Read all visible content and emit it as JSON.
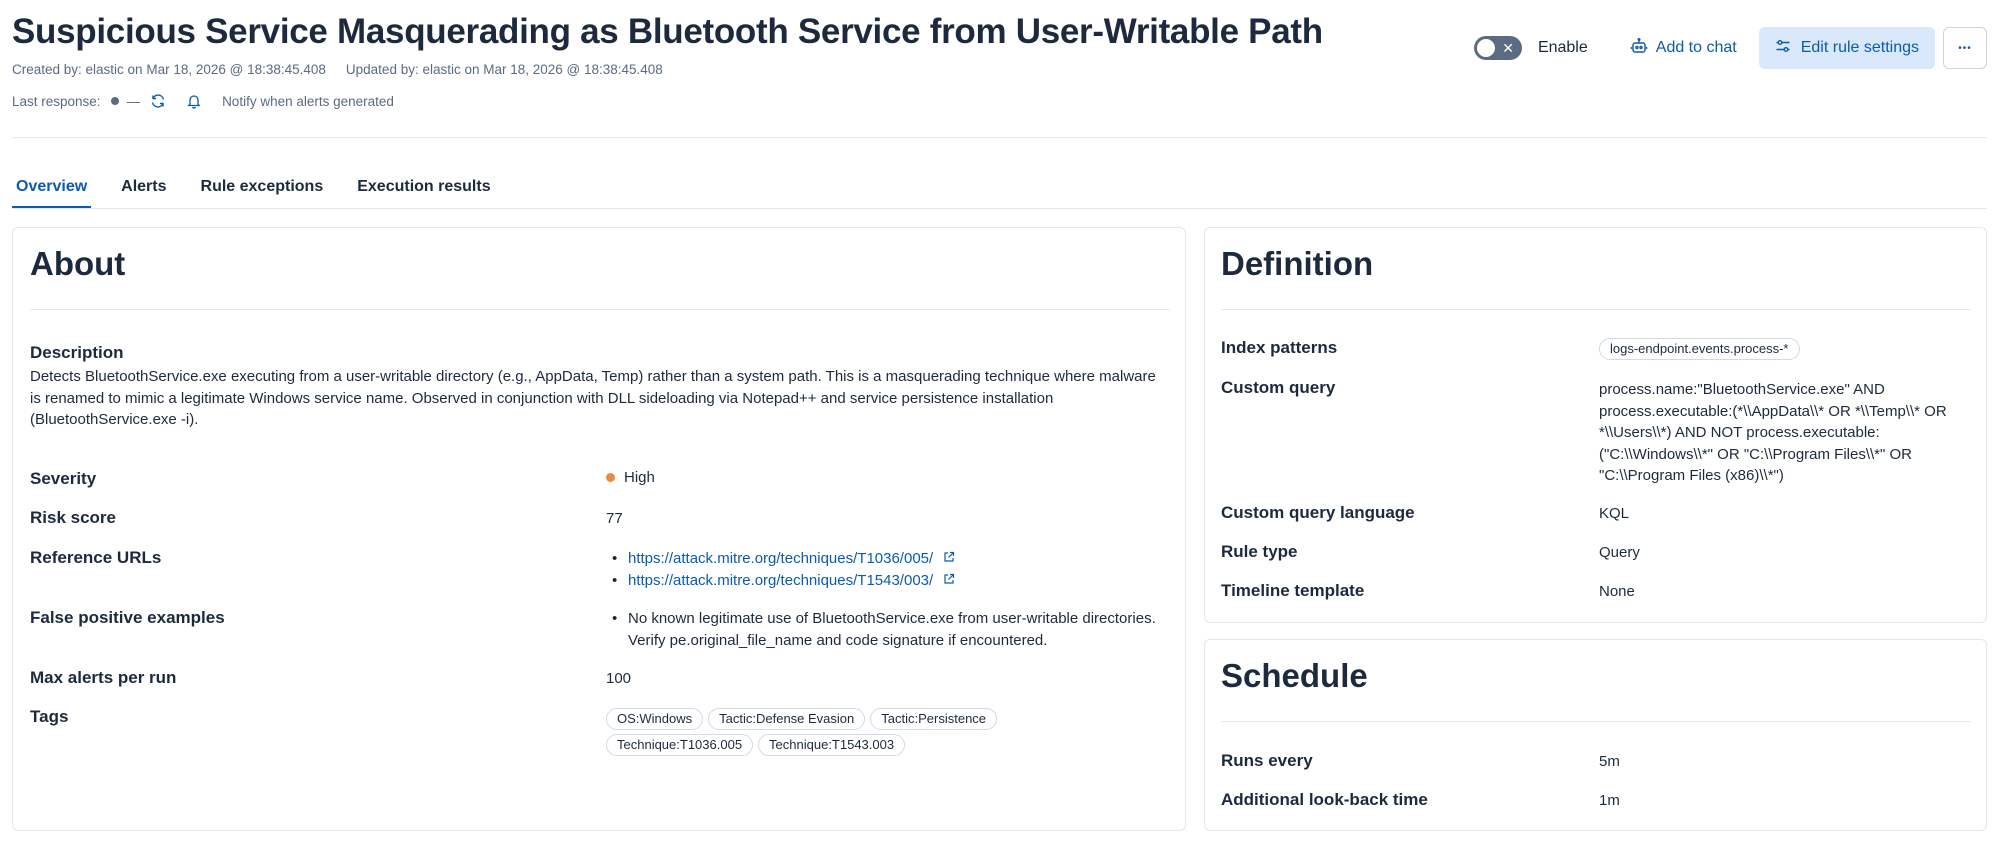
{
  "header": {
    "title": "Suspicious Service Masquerading as Bluetooth Service from User-Writable Path",
    "created_by": "Created by: elastic on Mar 18, 2026 @ 18:38:45.408",
    "updated_by": "Updated by: elastic on Mar 18, 2026 @ 18:38:45.408",
    "last_response_label": "Last response:",
    "last_response_value": "—",
    "notify_label": "Notify when alerts generated"
  },
  "actions": {
    "enable_label": "Enable",
    "add_to_chat_label": "Add to chat",
    "edit_rule_label": "Edit rule settings",
    "more_label": "•••"
  },
  "tabs": [
    {
      "label": "Overview",
      "active": true
    },
    {
      "label": "Alerts",
      "active": false
    },
    {
      "label": "Rule exceptions",
      "active": false
    },
    {
      "label": "Execution results",
      "active": false
    }
  ],
  "about": {
    "title": "About",
    "description_label": "Description",
    "description": "Detects BluetoothService.exe executing from a user-writable directory (e.g., AppData, Temp) rather than a system path. This is a masquerading technique where malware is renamed to mimic a legitimate Windows service name. Observed in conjunction with DLL sideloading via Notepad++ and service persistence installation (BluetoothService.exe -i).",
    "severity_label": "Severity",
    "severity_value": "High",
    "severity_color": "#e88b3b",
    "risk_score_label": "Risk score",
    "risk_score_value": "77",
    "reference_urls_label": "Reference URLs",
    "reference_urls": [
      "https://attack.mitre.org/techniques/T1036/005/",
      "https://attack.mitre.org/techniques/T1543/003/"
    ],
    "false_positive_label": "False positive examples",
    "false_positive_value": "No known legitimate use of BluetoothService.exe from user-writable directories. Verify pe.original_file_name and code signature if encountered.",
    "max_alerts_label": "Max alerts per run",
    "max_alerts_value": "100",
    "tags_label": "Tags",
    "tags": [
      "OS:Windows",
      "Tactic:Defense Evasion",
      "Tactic:Persistence",
      "Technique:T1036.005",
      "Technique:T1543.003"
    ]
  },
  "definition": {
    "title": "Definition",
    "index_patterns_label": "Index patterns",
    "index_patterns_value": "logs-endpoint.events.process-*",
    "custom_query_label": "Custom query",
    "custom_query_value": "process.name:\"BluetoothService.exe\" AND process.executable:(*\\\\AppData\\\\* OR *\\\\Temp\\\\* OR *\\\\Users\\\\*) AND NOT process.executable: (\"C:\\\\Windows\\\\*\" OR \"C:\\\\Program Files\\\\*\" OR \"C:\\\\Program Files (x86)\\\\*\")",
    "query_language_label": "Custom query language",
    "query_language_value": "KQL",
    "rule_type_label": "Rule type",
    "rule_type_value": "Query",
    "timeline_label": "Timeline template",
    "timeline_value": "None"
  },
  "schedule": {
    "title": "Schedule",
    "runs_every_label": "Runs every",
    "runs_every_value": "5m",
    "lookback_label": "Additional look-back time",
    "lookback_value": "1m"
  },
  "colors": {
    "link": "#0b5cad",
    "text": "#1d2a3e",
    "subdued": "#5a6b82",
    "primary_light_bg": "#d9e8fb"
  },
  "icons": [
    "refresh-icon",
    "bell-icon",
    "robot-icon",
    "sliders-icon",
    "external-link-icon",
    "close-icon"
  ]
}
